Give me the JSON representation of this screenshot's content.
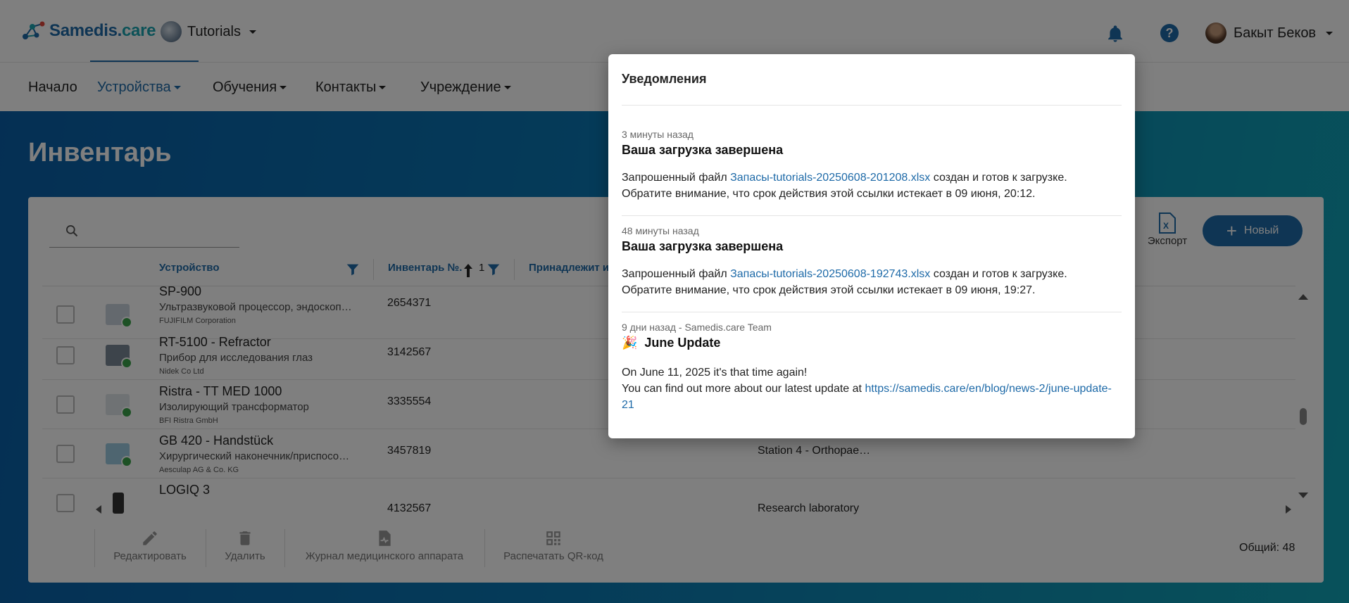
{
  "header": {
    "logo_main": "Samedis.",
    "logo_accent": "care",
    "tenant": "Tutorials",
    "user_name": "Бакыт Беков"
  },
  "nav": {
    "items": [
      {
        "label": "Начало"
      },
      {
        "label": "Устройства"
      },
      {
        "label": "Обучения"
      },
      {
        "label": "Контакты"
      },
      {
        "label": "Учреждение"
      }
    ]
  },
  "page": {
    "title": "Инвентарь",
    "export_label": "Экспорт",
    "new_label": "Новый",
    "columns": [
      "Устройство",
      "Инвентарь №.",
      "1",
      "Принадлежит и"
    ],
    "rows": [
      {
        "name": "SP-900",
        "type": "Ультразвуковой процессор, эндоскоп…",
        "maker": "FUJIFILM Corporation",
        "inv": "2654371",
        "loc": ""
      },
      {
        "name": "RT-5100 - Refractor",
        "type": "Прибор для исследования глаз",
        "maker": "Nidek Co Ltd",
        "inv": "3142567",
        "loc": ""
      },
      {
        "name": "Ristra - TT MED 1000",
        "type": "Изолирующий трансформатор",
        "maker": "BFI Ristra GmbH",
        "inv": "3335554",
        "loc": ""
      },
      {
        "name": "GB 420 - Handstück",
        "type": "Хирургический наконечник/приспосо…",
        "maker": "Aesculap AG & Co. KG",
        "inv": "3457819",
        "loc": "Station 4 - Orthopae…"
      },
      {
        "name": "LOGIQ 3",
        "type": "",
        "maker": "",
        "inv": "4132567",
        "loc": "Research laboratory"
      }
    ],
    "actions": [
      "Редактировать",
      "Удалить",
      "Журнал медицинского аппарата",
      "Распечатать QR-код"
    ],
    "total": "Общий: 48"
  },
  "notifications": {
    "title": "Уведомления",
    "items": [
      {
        "time": "3 минуты назад",
        "title": "Ваша загрузка завершена",
        "body_prefix": "Запрошенный файл ",
        "link": "Запасы-tutorials-20250608-201208.xlsx",
        "body_suffix": " создан и готов к загрузке.",
        "body_line2": "Обратите внимание, что срок действия этой ссылки истекает в 09 июня, 20:12."
      },
      {
        "time": "48 минуты назад",
        "title": "Ваша загрузка завершена",
        "body_prefix": "Запрошенный файл ",
        "link": "Запасы-tutorials-20250608-192743.xlsx",
        "body_suffix": " создан и готов к загрузке.",
        "body_line2": "Обратите внимание, что срок действия этой ссылки истекает в 09 июня, 19:27."
      },
      {
        "time": "9 дни назад - Samedis.care Team",
        "title_icon": "🎉",
        "title": "June Update",
        "body_line1": "On June 11, 2025 it's that time again!",
        "body_prefix": "You can find out more about our latest update at ",
        "link": "https://samedis.care/en/blog/news-2/june-update-21"
      }
    ]
  },
  "colors": {
    "brand_blue": "#1e6aa8",
    "brand_teal": "#1aa5b0",
    "status_green": "#3aa34a"
  }
}
